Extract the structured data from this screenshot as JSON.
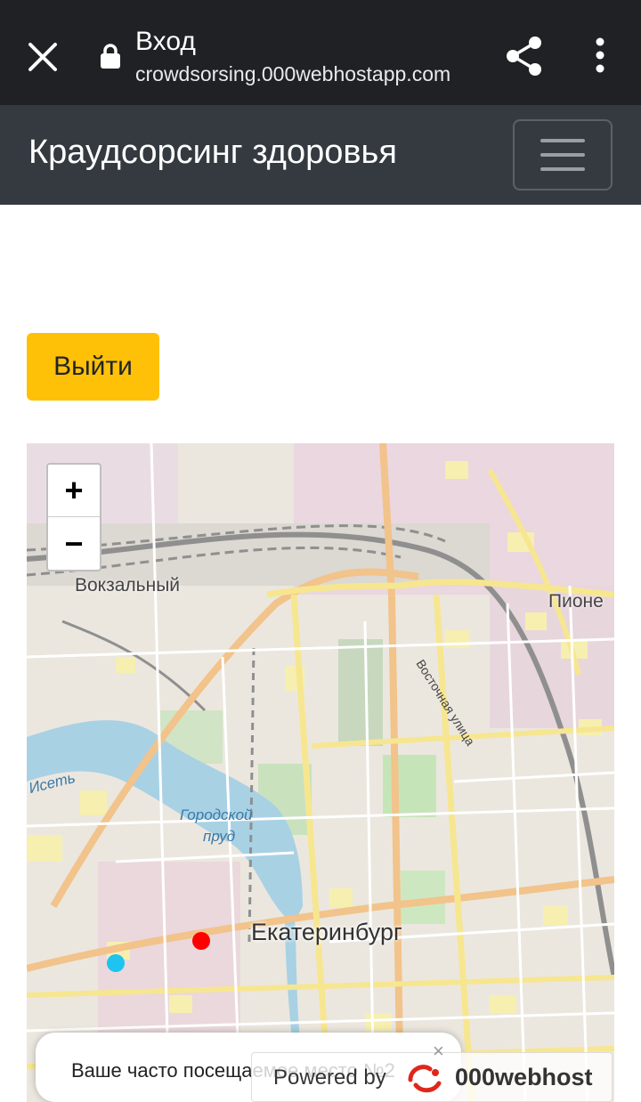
{
  "browser": {
    "title": "Вход",
    "url": "crowdsorsing.000webhostapp.com",
    "icons": [
      "close-icon",
      "lock-icon",
      "share-icon",
      "more-vert-icon"
    ]
  },
  "navbar": {
    "brand": "Краудсорсинг здоровья",
    "toggler_icon": "hamburger-icon"
  },
  "actions": {
    "logout_label": "Выйти",
    "logout_color": "#ffc107"
  },
  "map": {
    "zoom_in": "+",
    "zoom_out": "−",
    "labels": {
      "station": "Вокзальный",
      "district": "Пионе",
      "street": "Восточная улица",
      "river": "Исеть",
      "pond_line1": "Городской",
      "pond_line2": "пруд",
      "city": "Екатеринбург"
    },
    "markers": [
      {
        "color": "#ff0000"
      },
      {
        "color": "#1ec3f0"
      }
    ]
  },
  "toast": {
    "text": "Ваше часто посещаемое место №2"
  },
  "powered": {
    "label": "Powered by",
    "brand": "000webhost",
    "close": "×"
  }
}
